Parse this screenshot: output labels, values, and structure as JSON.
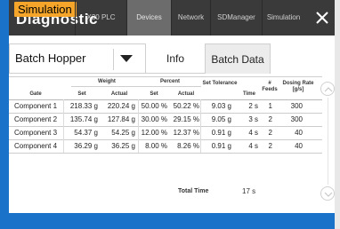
{
  "badge": "Simulation",
  "brand": "Diagnostic",
  "nav": {
    "tabs": [
      "X20 PLC",
      "Devices",
      "Network",
      "SDManager",
      "Simulation"
    ],
    "active": "Devices",
    "close_icon": "close-icon"
  },
  "subheader": {
    "dropdown_value": "Batch Hopper",
    "tabs": [
      "Info",
      "Batch Data"
    ],
    "active_tab": "Batch Data"
  },
  "table": {
    "group_headers": {
      "weight": "Weight",
      "percent": "Percent"
    },
    "headers": {
      "gate": "Gate",
      "set": "Set",
      "actual": "Actual",
      "percent_set": "Set",
      "percent_actual": "Actual",
      "tolerance": "Set Tolerance",
      "time": "Time",
      "feeds": "# Feeds",
      "dosing": "Dosing Rate [g/s]"
    },
    "rows": [
      {
        "gate": "Component 1",
        "set": "218.33 g",
        "actual": "220.24 g",
        "pset": "50.00 %",
        "pact": "50.22 %",
        "tol": "9.03 g",
        "time": "2 s",
        "feeds": "1",
        "rate": "300"
      },
      {
        "gate": "Component 2",
        "set": "135.74 g",
        "actual": "127.84 g",
        "pset": "30.00 %",
        "pact": "29.15 %",
        "tol": "9.05 g",
        "time": "3 s",
        "feeds": "2",
        "rate": "300"
      },
      {
        "gate": "Component 3",
        "set": "54.37 g",
        "actual": "54.25 g",
        "pset": "12.00 %",
        "pact": "12.37 %",
        "tol": "0.91 g",
        "time": "4 s",
        "feeds": "2",
        "rate": "40"
      },
      {
        "gate": "Component 4",
        "set": "36.29 g",
        "actual": "36.25 g",
        "pset": "8.00 %",
        "pact": "8.26 %",
        "tol": "0.91 g",
        "time": "4 s",
        "feeds": "2",
        "rate": "40"
      }
    ]
  },
  "total": {
    "label": "Total Time",
    "value": "17 s"
  },
  "colors": {
    "accent_blue": "#1a73c8",
    "badge": "#f5a62a",
    "topbar": "#3a3a3a"
  }
}
